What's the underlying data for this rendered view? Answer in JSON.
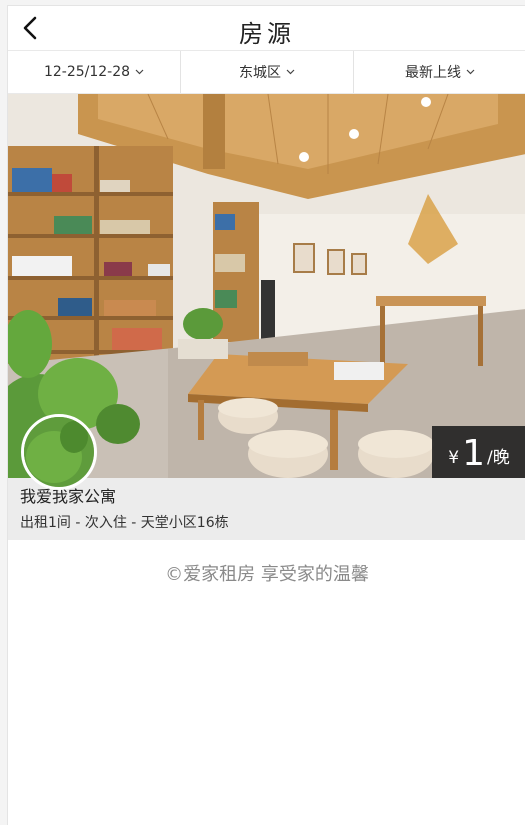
{
  "header": {
    "title": "房源"
  },
  "filters": {
    "dates": "12-25/12-28",
    "district": "东城区",
    "sort": "最新上线"
  },
  "listing": {
    "name": "我爱我家公寓",
    "details": "出租1间 - 次入住 - 天堂小区16栋",
    "price_currency": "¥",
    "price_value": "1",
    "price_unit": "/晚"
  },
  "footer": {
    "slogan": "©爱家租房  享受家的温馨"
  },
  "icons": {
    "back": "chevron-left-icon",
    "dropdown": "chevron-down-icon"
  }
}
